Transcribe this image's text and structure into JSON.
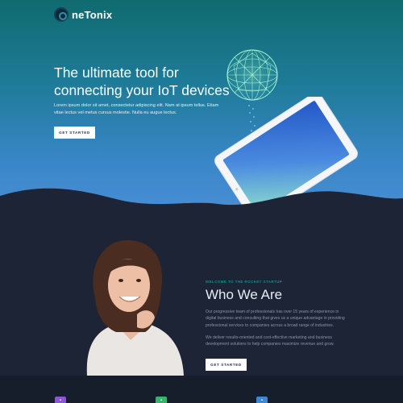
{
  "brand": {
    "name": "neTonix"
  },
  "hero": {
    "title": "The ultimate tool for connecting your IoT devices",
    "text": "Lorem ipsum dolor sit amet, consectetur adipiscing elit. Nam at ipsum tellus. Etiam vitae lectus vel metus cursus molestie. Nulla eu augue lectus.",
    "button": "GET STARTED"
  },
  "about": {
    "kicker": "WELCOME TO THE ROCKET STARTUP",
    "title": "Who We Are",
    "paragraph1": "Our progressive team of professionals has over 15 years of experience in digital business and consulting that gives us a unique advantage in providing professional services to companies across a broad range of industries.",
    "paragraph2": "We deliver results-oriented and cost-effective marketing and business development solutions to help companies maximize revenue and grow.",
    "button": "GET STARTED"
  },
  "features": {
    "icons": [
      "feature-icon-purple",
      "feature-icon-green",
      "feature-icon-blue"
    ]
  },
  "colors": {
    "hero_top": "#0f6b6f",
    "hero_bottom": "#4a8fd6",
    "dark_bg": "#1c2436",
    "accent_teal": "#1a8a89"
  }
}
